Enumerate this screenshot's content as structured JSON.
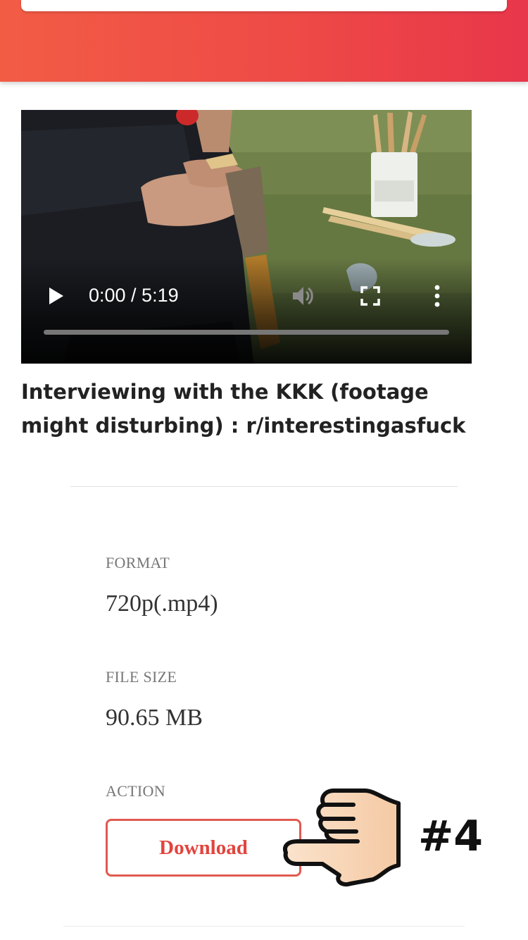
{
  "video": {
    "time_display": "0:00 / 5:19",
    "progress_fraction": 0,
    "play_icon": "play-icon",
    "volume_icon": "volume-icon",
    "fullscreen_icon": "fullscreen-icon",
    "more_icon": "more-vert-icon"
  },
  "title": "Interviewing with the KKK (footage might disturbing) : r/interestingasfuck",
  "details": {
    "format_label": "FORMAT",
    "format_value": "720p(.mp4)",
    "size_label": "FILE SIZE",
    "size_value": "90.65 MB",
    "action_label": "ACTION",
    "download_label": "Download"
  },
  "annotation": {
    "marker": "#4",
    "pointer_icon": "pointing-hand-icon"
  },
  "colors": {
    "header_start": "#f25c45",
    "header_end": "#e8364a",
    "download_accent": "#e2443e"
  }
}
